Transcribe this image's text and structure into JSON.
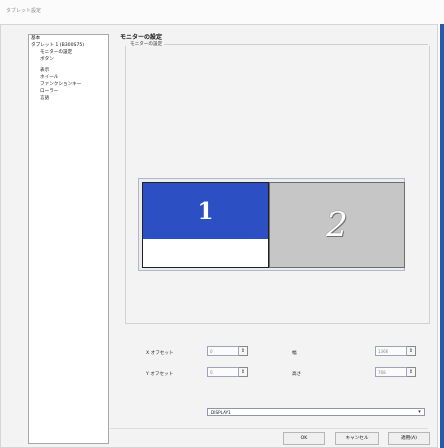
{
  "window": {
    "title": "タブレット設定"
  },
  "tree": {
    "items": [
      {
        "label": "基本"
      },
      {
        "label": "タブレット 1 (B300S75)"
      },
      {
        "label": "モニターの設定"
      },
      {
        "label": "ボタン"
      },
      {
        "label": "表示"
      },
      {
        "label": "ホイール"
      },
      {
        "label": "ファンクションキー"
      },
      {
        "label": "ローラー"
      },
      {
        "label": "言語"
      }
    ]
  },
  "main": {
    "title": "モニターの設定",
    "group_label": "モニターの設定",
    "preview": {
      "monitor_1": "1",
      "monitor_2": "2"
    },
    "form": {
      "x_offset": {
        "label": "X オフセット",
        "value": "0"
      },
      "y_offset": {
        "label": "Y オフセット",
        "value": "0"
      },
      "width": {
        "label": "幅",
        "value": "1366"
      },
      "height": {
        "label": "高さ",
        "value": "768"
      }
    },
    "display_select": {
      "value": "DISPLAY1"
    }
  },
  "buttons": {
    "ok": "OK",
    "cancel": "キャンセル",
    "apply": "適用(A)"
  }
}
